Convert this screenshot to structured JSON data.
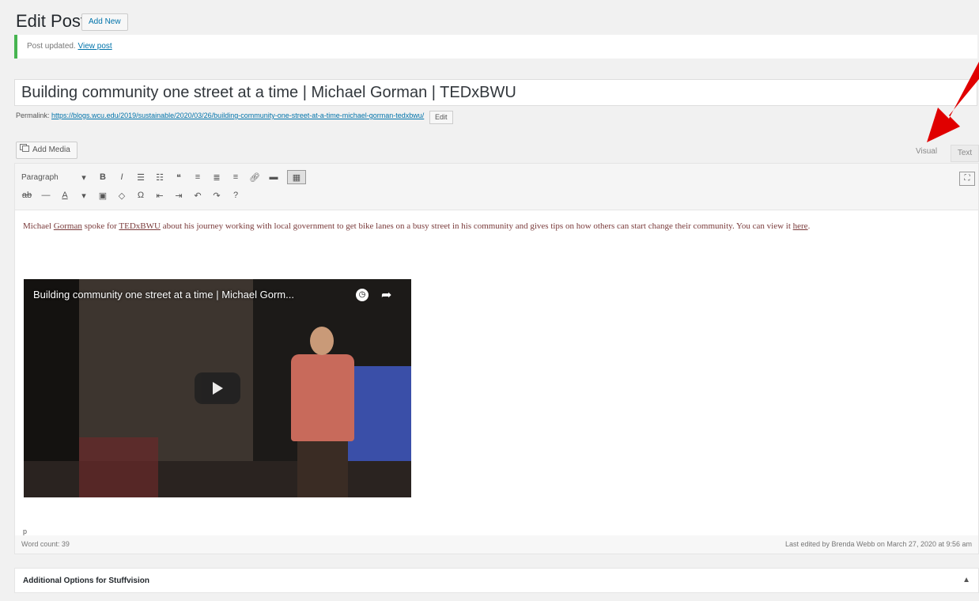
{
  "header": {
    "title": "Edit Post",
    "add_new_label": "Add New"
  },
  "notice": {
    "text": "Post updated.",
    "link": "View post"
  },
  "post": {
    "title": "Building community one street at a time | Michael Gorman | TEDxBWU"
  },
  "permalink": {
    "label": "Permalink:",
    "url": "https://blogs.wcu.edu/2019/sustainable/2020/03/26/building-community-one-street-at-a-time-michael-gorman-tedxbwu/",
    "edit_label": "Edit"
  },
  "editor": {
    "add_media_label": "Add Media",
    "tab_visual": "Visual",
    "tab_text": "Text",
    "format_select": "Paragraph",
    "toolbar_row1": [
      "bold-icon",
      "italic-icon",
      "bullet-list-icon",
      "numbered-list-icon",
      "blockquote-icon",
      "align-left-icon",
      "align-center-icon",
      "align-right-icon",
      "link-icon",
      "readmore-icon",
      "toolbar-toggle-icon"
    ],
    "toolbar_row2": [
      "strikethrough-icon",
      "horizontal-rule-icon",
      "text-color-icon",
      "paste-text-icon",
      "clear-formatting-icon",
      "special-char-icon",
      "outdent-icon",
      "indent-icon",
      "undo-icon",
      "redo-icon",
      "help-icon"
    ],
    "fullscreen_icon": "distraction-free-icon",
    "content": {
      "part1": "Michael ",
      "name_link": "Gorman",
      "part2": " spoke for ",
      "ted_link": "TEDxBWU",
      "part3": " about his journey working with local government to get bike lanes on a busy street in his community and gives tips on how others can start change their community. You can view it ",
      "here_link": "here",
      "part4": "."
    },
    "video_title": "Building community one street at a time | Michael Gorm...",
    "path_indicator": "p",
    "word_count": "Word count: 39",
    "last_edited": "Last edited by Brenda Webb on March 27, 2020 at 9:56 am"
  },
  "additional_options": {
    "title": "Additional Options for Stuffvision",
    "toggle": "▲"
  },
  "colors": {
    "accent": "#0073aa",
    "notice_border": "#46b450",
    "arrow": "#e00000"
  }
}
